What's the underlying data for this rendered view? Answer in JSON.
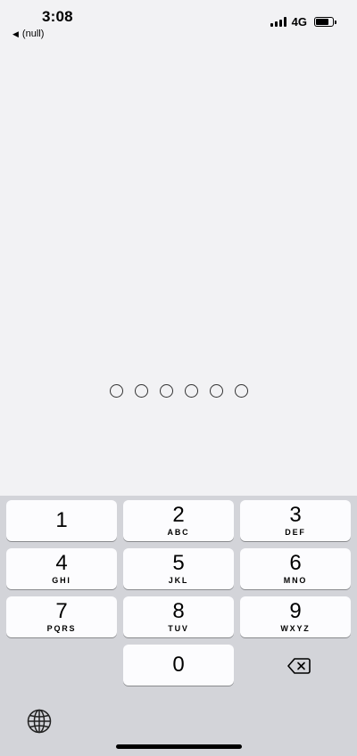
{
  "status_bar": {
    "time": "3:08",
    "back_label": "(null)",
    "network": "4G",
    "signal_bars": 4,
    "battery_level": 0.85
  },
  "passcode": {
    "length": 6,
    "entered": 0
  },
  "keypad": {
    "keys": [
      {
        "digit": "1",
        "letters": ""
      },
      {
        "digit": "2",
        "letters": "ABC"
      },
      {
        "digit": "3",
        "letters": "DEF"
      },
      {
        "digit": "4",
        "letters": "GHI"
      },
      {
        "digit": "5",
        "letters": "JKL"
      },
      {
        "digit": "6",
        "letters": "MNO"
      },
      {
        "digit": "7",
        "letters": "PQRS"
      },
      {
        "digit": "8",
        "letters": "TUV"
      },
      {
        "digit": "9",
        "letters": "WXYZ"
      },
      {
        "digit": "0",
        "letters": ""
      }
    ],
    "delete_icon": "delete-backspace-icon",
    "globe_icon": "globe-icon"
  },
  "colors": {
    "background": "#f2f2f4",
    "keyboard_background": "#d3d4d9",
    "key_background": "#fcfcfe"
  }
}
